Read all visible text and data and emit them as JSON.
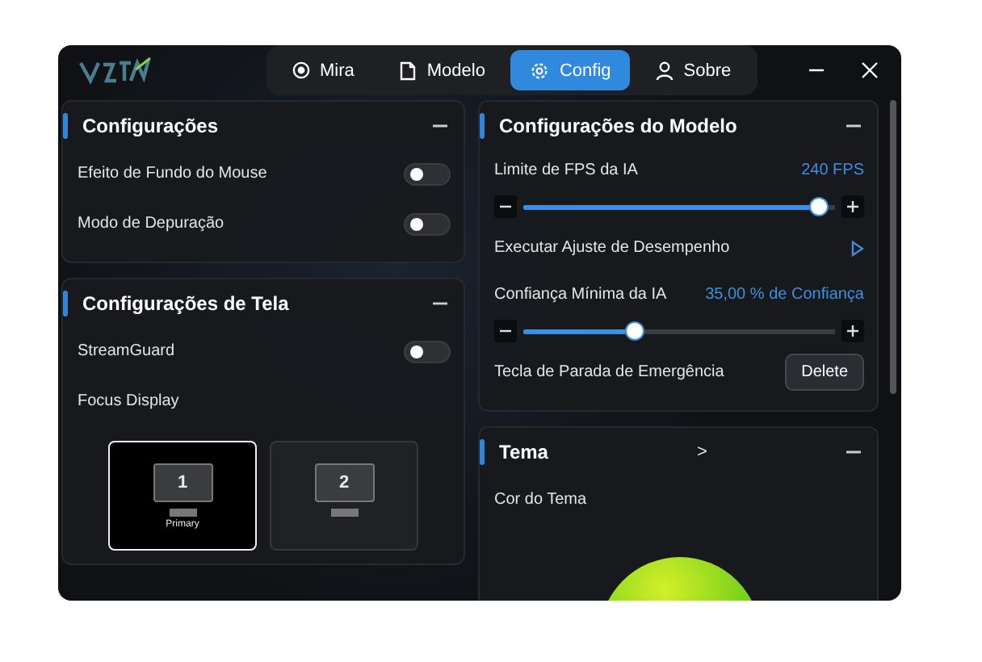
{
  "tabs": [
    {
      "label": "Mira",
      "kind": "target",
      "selected": false
    },
    {
      "label": "Modelo",
      "kind": "file",
      "selected": false
    },
    {
      "label": "Config",
      "kind": "gear",
      "selected": true
    },
    {
      "label": "Sobre",
      "kind": "user",
      "selected": false
    }
  ],
  "columns": [
    {
      "panels": [
        {
          "title": "Configurações",
          "rows": [
            {
              "kind": "toggle",
              "label": "Efeito de Fundo do Mouse",
              "on": false
            },
            {
              "kind": "toggle",
              "label": "Modo de Depuração",
              "on": false
            }
          ]
        },
        {
          "title": "Configurações de Tela",
          "rows": [
            {
              "kind": "toggle",
              "label": "StreamGuard",
              "on": false
            },
            {
              "kind": "label",
              "label": "Focus Display"
            },
            {
              "kind": "displays",
              "displays": [
                {
                  "number": "1",
                  "caption": "Primary",
                  "selected": true
                },
                {
                  "number": "2",
                  "selected": false
                }
              ]
            }
          ]
        }
      ]
    },
    {
      "panels": [
        {
          "title": "Configurações do Modelo",
          "rows": [
            {
              "kind": "slider",
              "label": "Limite de FPS da IA",
              "reading": "240 FPS",
              "level": 0.98
            },
            {
              "kind": "action",
              "label": "Executar Ajuste de Desempenho"
            },
            {
              "kind": "slider",
              "label": "Confiança Mínima da IA",
              "reading": "35,00 % de Confiança",
              "level": 0.35
            },
            {
              "kind": "key",
              "label": "Tecla de Parada de Emergência",
              "key": "Delete"
            }
          ]
        },
        {
          "title": "Tema",
          "extra": ">",
          "rows": [
            {
              "kind": "label",
              "label": "Cor do Tema"
            },
            {
              "kind": "wheel"
            }
          ]
        }
      ]
    }
  ]
}
